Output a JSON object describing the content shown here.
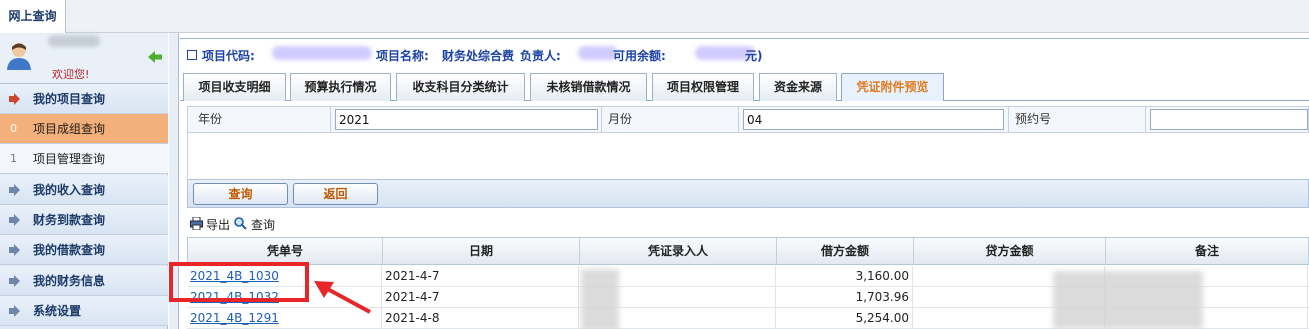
{
  "topbar": {
    "tab_label": "网上查询"
  },
  "sidebar": {
    "welcome": "欢迎您!",
    "items": [
      {
        "label": "我的项目查询",
        "type": "header"
      },
      {
        "idx": "0",
        "label": "项目成组查询",
        "type": "sub",
        "active": true
      },
      {
        "idx": "1",
        "label": "项目管理查询",
        "type": "sub"
      },
      {
        "label": "我的收入查询",
        "type": "header"
      },
      {
        "label": "财务到款查询",
        "type": "header"
      },
      {
        "label": "我的借款查询",
        "type": "header"
      },
      {
        "label": "我的财务信息",
        "type": "header"
      },
      {
        "label": "系统设置",
        "type": "header"
      }
    ]
  },
  "info": {
    "project_code_label": "项目代码:",
    "project_name_label": "项目名称:",
    "project_name": "财务处综合费",
    "manager_label": "负责人:",
    "balance_label": "可用余额:",
    "balance_unit": "元)"
  },
  "tabs": [
    {
      "label": "项目收支明细"
    },
    {
      "label": "预算执行情况"
    },
    {
      "label": "收支科目分类统计"
    },
    {
      "label": "未核销借款情况"
    },
    {
      "label": "项目权限管理"
    },
    {
      "label": "资金来源"
    },
    {
      "label": "凭证附件预览",
      "active": true
    }
  ],
  "form": {
    "year_label": "年份",
    "year_value": "2021",
    "month_label": "月份",
    "month_value": "04",
    "reservation_label": "预约号",
    "reservation_value": ""
  },
  "buttons": {
    "query": "查询",
    "back": "返回"
  },
  "grid_toolbar": {
    "export": "导出",
    "search": "查询"
  },
  "table": {
    "headers": [
      "凭单号",
      "日期",
      "凭证录入人",
      "借方金额",
      "贷方金额",
      "备注"
    ],
    "rows": [
      {
        "voucher": "2021_4B_1030",
        "date": "2021-4-7",
        "entry_by": "",
        "debit": "3,160.00",
        "credit": "",
        "note": ""
      },
      {
        "voucher": "2021_4B_1032",
        "date": "2021-4-7",
        "entry_by": "",
        "debit": "1,703.96",
        "credit": "",
        "note": ""
      },
      {
        "voucher": "2021_4B_1291",
        "date": "2021-4-8",
        "entry_by": "",
        "debit": "5,254.00",
        "credit": "",
        "note": ""
      }
    ]
  },
  "colors": {
    "accent_orange": "#e07b1e",
    "link_blue": "#1c5fb8",
    "highlight_red": "#e8262a",
    "nav_active": "#f4b07a"
  }
}
